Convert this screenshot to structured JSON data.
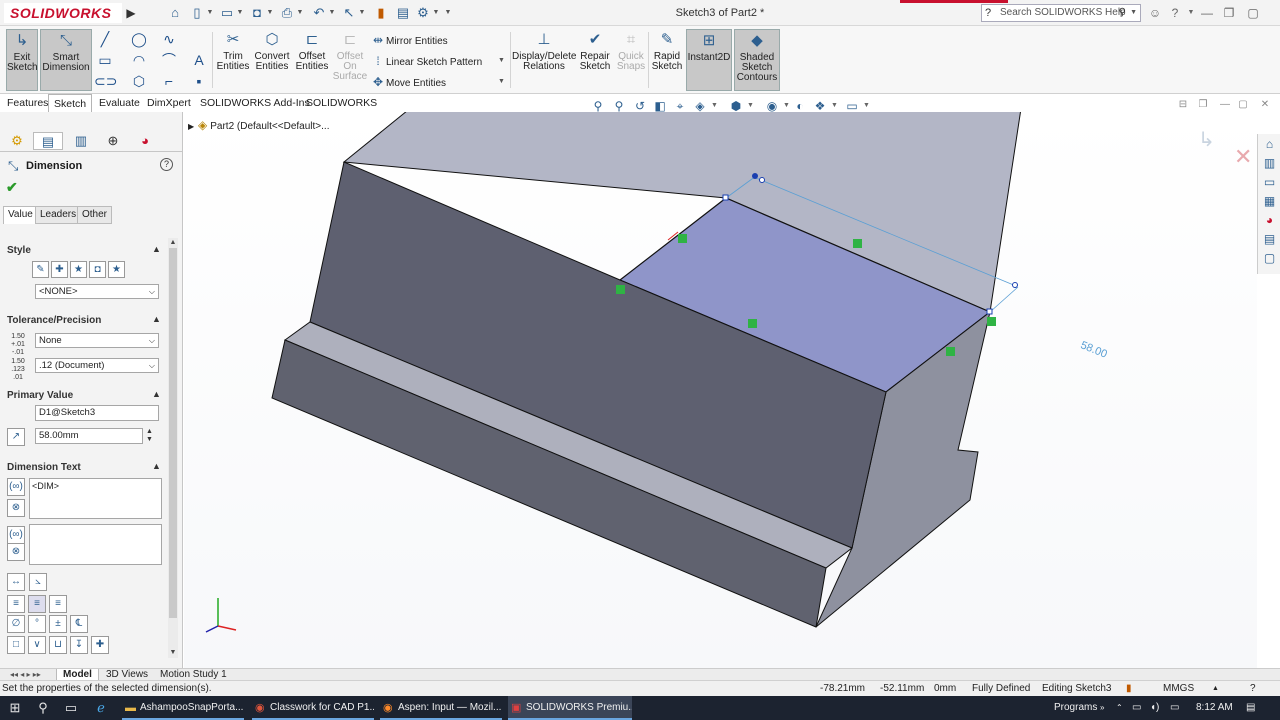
{
  "app": {
    "brand": "SOLIDWORKS",
    "doc_title": "Sketch3 of Part2 *",
    "search_placeholder": "Search SOLIDWORKS Help"
  },
  "command_manager": {
    "exit_sketch": "Exit Sketch",
    "smart_dimension": "Smart Dimension",
    "trim_entities": "Trim Entities",
    "convert_entities": "Convert Entities",
    "offset_entities": "Offset Entities",
    "offset_on_surface": "Offset On Surface",
    "mirror_entities": "Mirror Entities",
    "linear_sketch_pattern": "Linear Sketch Pattern",
    "move_entities": "Move Entities",
    "display_delete_relations": "Display/Delete Relations",
    "repair_sketch": "Repair Sketch",
    "quick_snaps": "Quick Snaps",
    "rapid_sketch": "Rapid Sketch",
    "instant2d": "Instant2D",
    "shaded_sketch_contours": "Shaded Sketch Contours"
  },
  "tabs": [
    "Features",
    "Sketch",
    "Evaluate",
    "DimXpert",
    "SOLIDWORKS Add-Ins",
    "SOLIDWORKS MBD"
  ],
  "feature_tree": {
    "root": "Part2  (Default<<Default>..."
  },
  "property_manager": {
    "title": "Dimension",
    "subtabs": [
      "Value",
      "Leaders",
      "Other"
    ],
    "style": {
      "label": "Style",
      "selected": "<NONE>"
    },
    "tolerance": {
      "label": "Tolerance/Precision",
      "type": "None",
      "precision": ".12 (Document)",
      "type_icon_text": "1.50 +.01 -.01",
      "precision_icon_text": "1.50 .123 .01"
    },
    "primary_value": {
      "label": "Primary Value",
      "name": "D1@Sketch3",
      "value": "58.00mm"
    },
    "dimension_text": {
      "label": "Dimension Text",
      "text": "<DIM>"
    }
  },
  "model": {
    "dimension_value": "58.00"
  },
  "bottom_tabs": [
    "Model",
    "3D Views",
    "Motion Study 1"
  ],
  "status": {
    "message": "Set the properties of the selected dimension(s).",
    "x": "-78.21mm",
    "y": "-52.11mm",
    "z": "0mm",
    "state": "Fully Defined",
    "mode": "Editing Sketch3",
    "units": "MMGS"
  },
  "taskbar": {
    "apps": [
      "AshampooSnapPorta...",
      "Classwork for CAD P1...",
      "Aspen: Input — Mozil...",
      "SOLIDWORKS Premiu..."
    ],
    "programs": "Programs",
    "time": "8:12 AM"
  },
  "colors": {
    "brand_red": "#c8102e",
    "face_selected": "#8f95c9",
    "dimension_blue": "#5a9fd4",
    "relation_green": "#2fb344"
  }
}
